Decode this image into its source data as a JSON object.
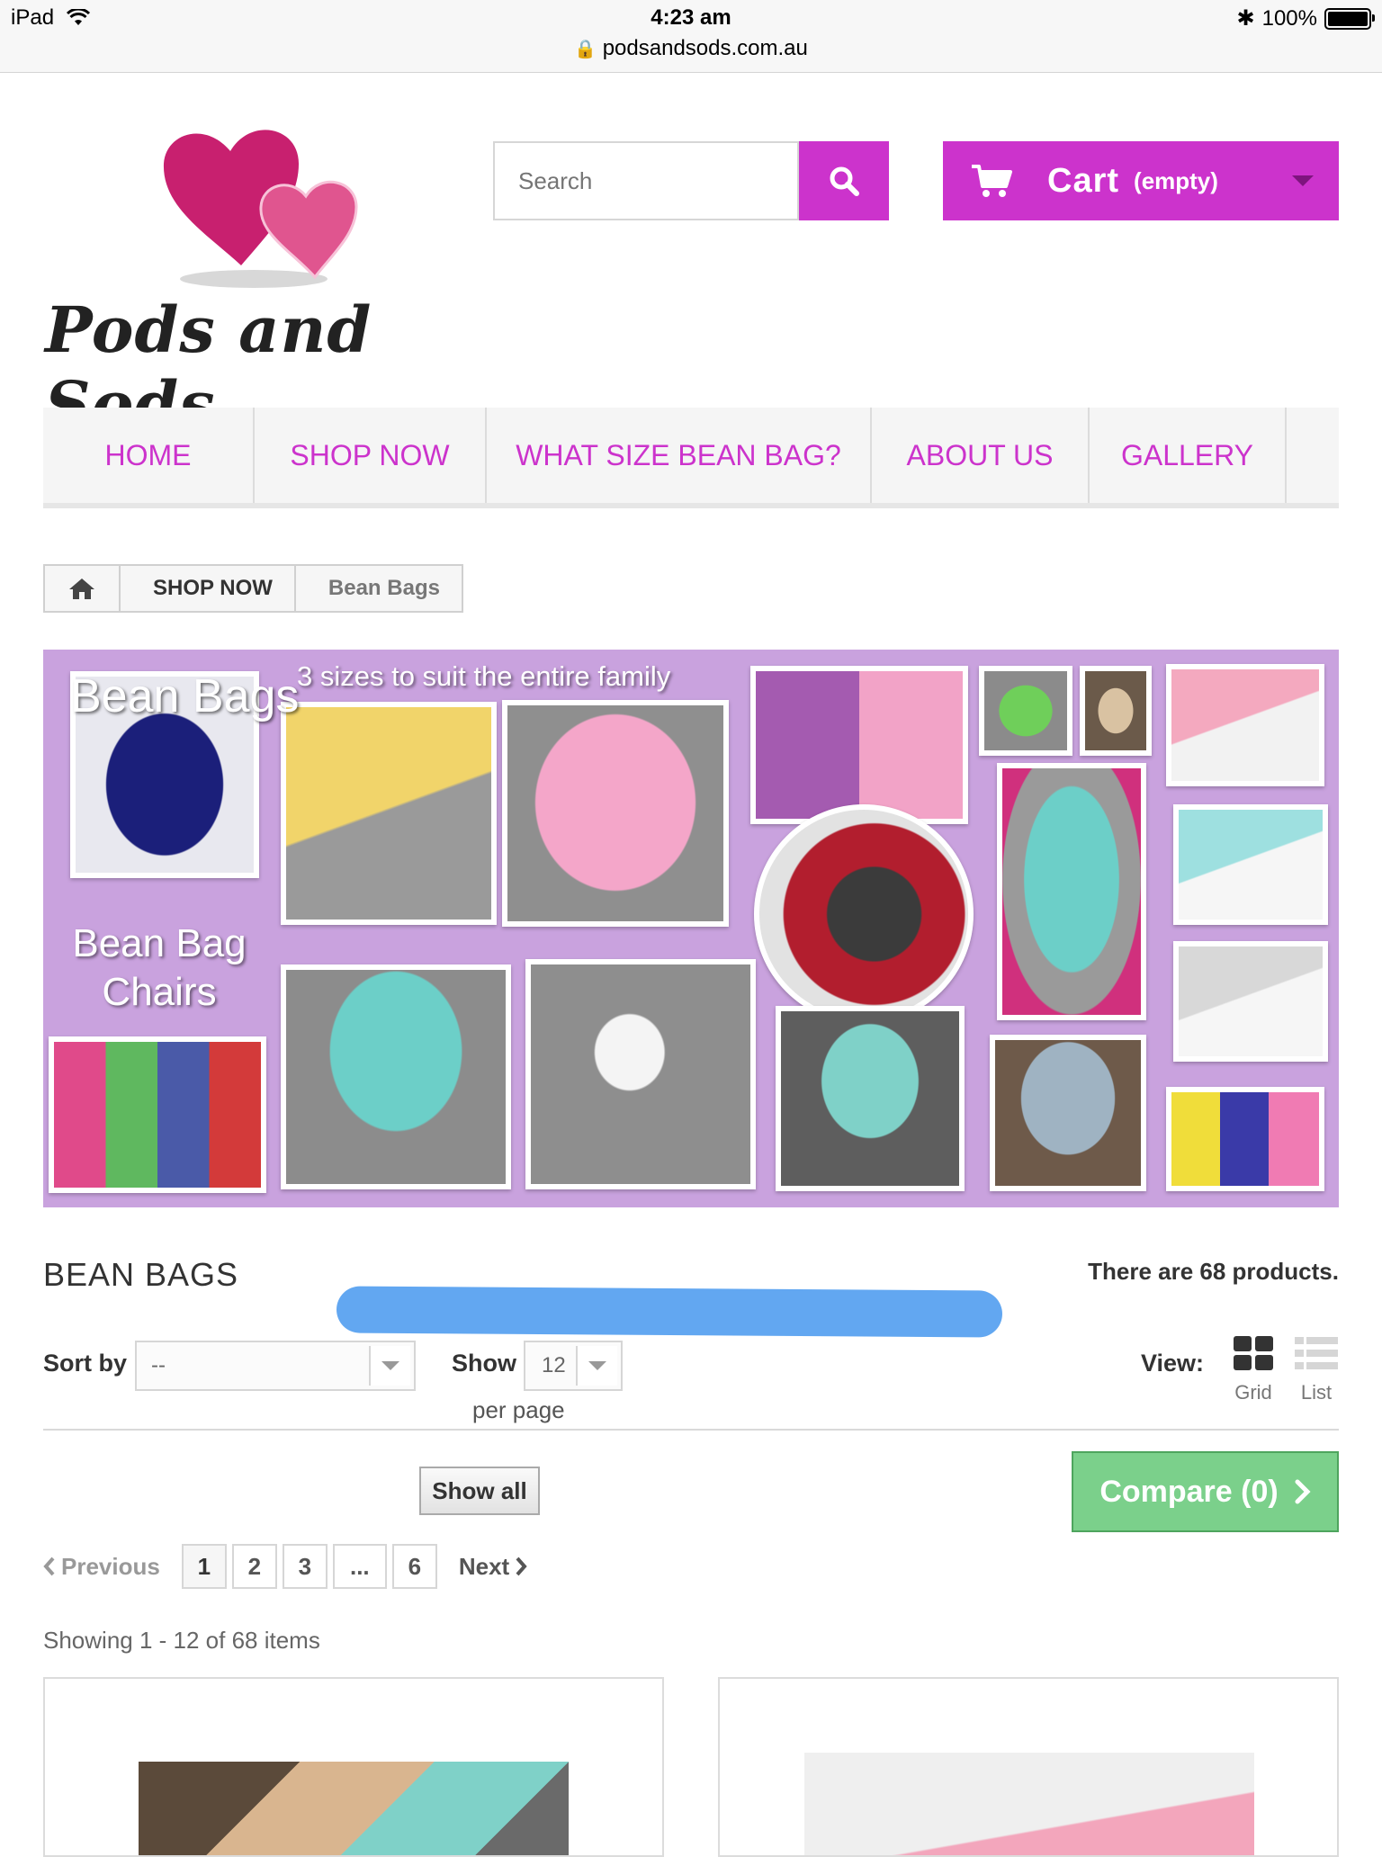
{
  "status_bar": {
    "device": "iPad",
    "time": "4:23 am",
    "url": "podsandsods.com.au",
    "battery": "100%"
  },
  "logo": {
    "text": "Pods and Sods"
  },
  "search": {
    "placeholder": "Search"
  },
  "cart": {
    "label": "Cart",
    "status": "(empty)"
  },
  "nav": {
    "items": [
      {
        "label": "HOME"
      },
      {
        "label": "SHOP NOW"
      },
      {
        "label": "WHAT SIZE BEAN BAG?"
      },
      {
        "label": "ABOUT US"
      },
      {
        "label": "GALLERY"
      }
    ]
  },
  "breadcrumb": {
    "items": [
      "SHOP NOW",
      "Bean Bags"
    ]
  },
  "banner": {
    "heading": "Bean Bags",
    "tagline": "3 sizes to suit the entire family",
    "sub_line1": "Bean Bag",
    "sub_line2": "Chairs"
  },
  "category": {
    "title": "BEAN BAGS",
    "count_text": "There are 68 products."
  },
  "toolbar": {
    "sort_label": "Sort by",
    "sort_value": "--",
    "show_label": "Show",
    "show_value": "12",
    "per_page": "per page",
    "view_label": "View:",
    "grid_label": "Grid",
    "list_label": "List",
    "show_all": "Show all",
    "compare": "Compare (0)"
  },
  "pagination": {
    "previous": "Previous",
    "pages": [
      "1",
      "2",
      "3",
      "...",
      "6"
    ],
    "next": "Next",
    "showing": "Showing 1 - 12 of 68 items"
  },
  "colors": {
    "brand": "#cc33cc",
    "compare": "#7bd08b",
    "banner_bg": "#c9a2de"
  }
}
